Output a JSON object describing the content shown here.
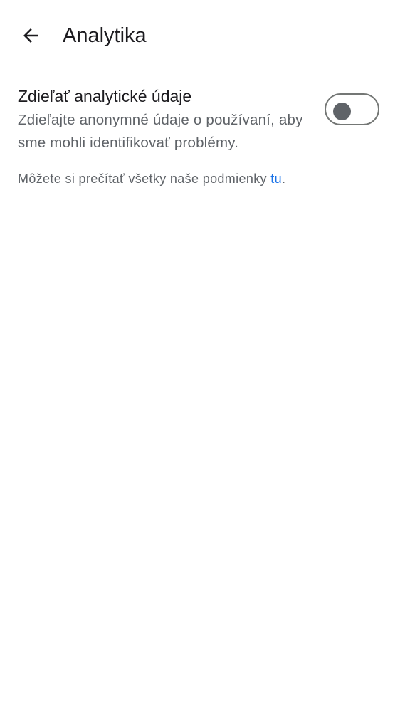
{
  "header": {
    "title": "Analytika",
    "back_icon": "arrow-back-icon"
  },
  "analytics_setting": {
    "title": "Zdieľať analytické údaje",
    "description": "Zdieľajte anonymné údaje o používaní, aby sme mohli identifikovať problémy.",
    "toggle_on": false
  },
  "terms": {
    "text_before": "Môžete si prečítať všetky naše podmienky ",
    "link_text": "tu",
    "text_after": "."
  },
  "colors": {
    "background": "#ffffff",
    "primary_text": "#1c1b1f",
    "secondary_text": "#5f6368",
    "link": "#1a73e8",
    "toggle_outline": "#747775"
  }
}
